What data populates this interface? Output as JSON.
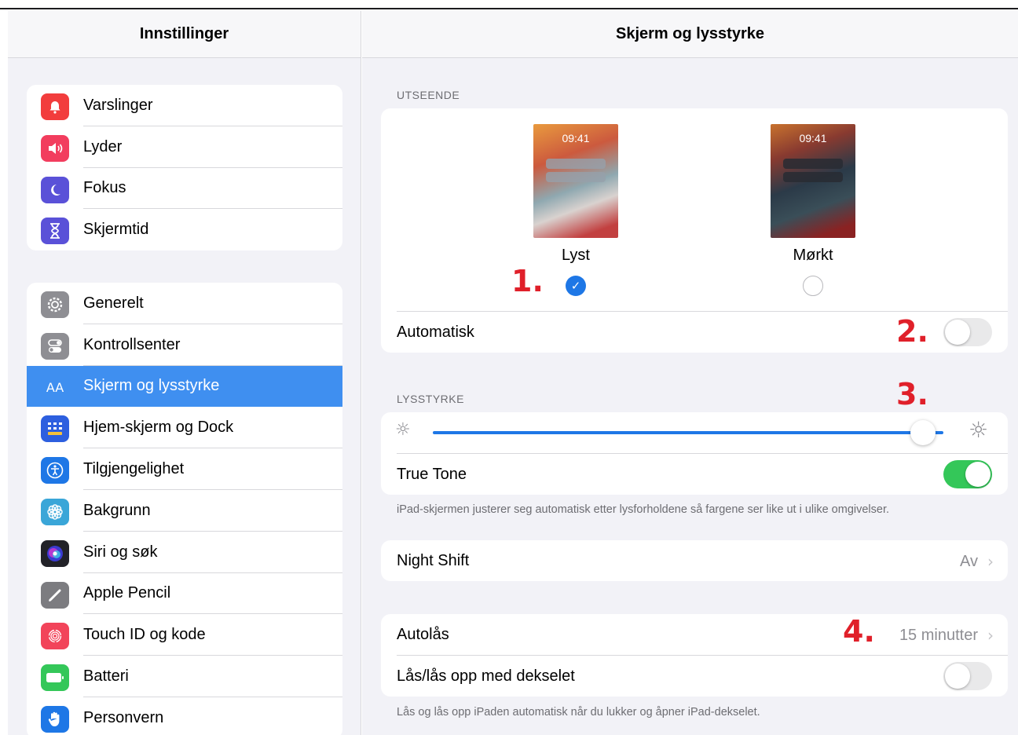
{
  "sidebar": {
    "title": "Innstillinger",
    "group1": [
      {
        "label": "Varslinger",
        "icon": "bell-icon",
        "color": "#f23d3d"
      },
      {
        "label": "Lyder",
        "icon": "speaker-icon",
        "color": "#f23d5e"
      },
      {
        "label": "Fokus",
        "icon": "moon-icon",
        "color": "#5a51d8"
      },
      {
        "label": "Skjermtid",
        "icon": "hourglass-icon",
        "color": "#5a51d8"
      }
    ],
    "group2": [
      {
        "label": "Generelt",
        "icon": "gear-icon",
        "color": "#8e8e93"
      },
      {
        "label": "Kontrollsenter",
        "icon": "switches-icon",
        "color": "#8e8e93"
      },
      {
        "label": "Skjerm og lysstyrke",
        "icon": "text-size-icon",
        "color": "#3f8ff0",
        "active": true
      },
      {
        "label": "Hjem-skjerm og Dock",
        "icon": "grid-icon",
        "color": "#2d5fdf"
      },
      {
        "label": "Tilgjengelighet",
        "icon": "accessibility-icon",
        "color": "#1e77e6"
      },
      {
        "label": "Bakgrunn",
        "icon": "flower-icon",
        "color": "#3aa6d8"
      },
      {
        "label": "Siri og søk",
        "icon": "siri-icon",
        "color": "#222228"
      },
      {
        "label": "Apple Pencil",
        "icon": "pencil-icon",
        "color": "#7c7c80"
      },
      {
        "label": "Touch ID og kode",
        "icon": "fingerprint-icon",
        "color": "#f2445a"
      },
      {
        "label": "Batteri",
        "icon": "battery-icon",
        "color": "#34c759"
      },
      {
        "label": "Personvern",
        "icon": "hand-icon",
        "color": "#1e77e6"
      }
    ]
  },
  "main": {
    "title": "Skjerm og lysstyrke",
    "appearance": {
      "section_label": "UTSEENDE",
      "light": {
        "time": "09:41",
        "label": "Lyst",
        "selected": true
      },
      "dark": {
        "time": "09:41",
        "label": "Mørkt",
        "selected": false
      },
      "automatic_label": "Automatisk",
      "automatic_on": false
    },
    "brightness": {
      "section_label": "LYSSTYRKE",
      "level": 0.96,
      "true_tone_label": "True Tone",
      "true_tone_on": true,
      "note": "iPad-skjermen justerer seg automatisk etter lysforholdene så fargene ser like ut i ulike omgivelser."
    },
    "night_shift": {
      "label": "Night Shift",
      "value": "Av"
    },
    "autolock": {
      "label": "Autolås",
      "value": "15 minutter"
    },
    "cover_lock": {
      "label": "Lås/lås opp med dekselet",
      "on": false,
      "note": "Lås og lås opp iPaden automatisk når du lukker og åpner iPad-dekselet."
    }
  },
  "annotations": {
    "a1": "1.",
    "a2": "2.",
    "a3": "3.",
    "a4": "4."
  },
  "colors": {
    "accent": "#1e77e6",
    "annotation": "#e0202a",
    "toggle_on": "#34c759"
  }
}
